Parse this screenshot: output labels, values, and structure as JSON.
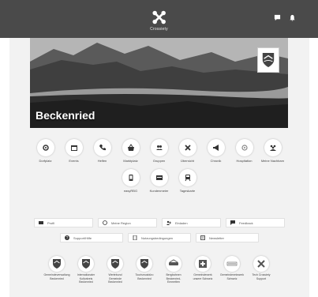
{
  "app": {
    "name": "Crossiety"
  },
  "header": {
    "icons": [
      "chat-icon",
      "bell-icon"
    ]
  },
  "hero": {
    "title": "Beckenried"
  },
  "apps": [
    {
      "label": "Dorfplatz",
      "icon": "gear-icon"
    },
    {
      "label": "Events",
      "icon": "calendar-icon"
    },
    {
      "label": "Helfen",
      "icon": "phone-icon"
    },
    {
      "label": "Marktplatz",
      "icon": "basket-icon"
    },
    {
      "label": "Gruppen",
      "icon": "people-icon"
    },
    {
      "label": "Übersicht",
      "icon": "crossiety-icon"
    },
    {
      "label": "Chronik",
      "icon": "megaphone-icon"
    },
    {
      "label": "Hospitation",
      "icon": "flower-icon"
    },
    {
      "label": "Meine Nachbarn",
      "icon": "neighbors-icon"
    },
    {
      "label": "easyRBG",
      "icon": "phone-doc-icon"
    },
    {
      "label": "Kundenmeier",
      "icon": "card-icon"
    },
    {
      "label": "Tageskarte",
      "icon": "train-icon"
    }
  ],
  "links": {
    "row1": [
      {
        "label": "Profil",
        "icon": "id-icon"
      },
      {
        "label": "Meine Region",
        "icon": "globe-icon"
      },
      {
        "label": "Einladen",
        "icon": "invite-icon"
      },
      {
        "label": "Feedback",
        "icon": "feedback-icon"
      }
    ],
    "row2": [
      {
        "label": "Support/Hilfe",
        "icon": "question-icon"
      },
      {
        "label": "Nutzungsbedingungen",
        "icon": "doc-icon"
      },
      {
        "label": "Newsletter",
        "icon": "newsletter-icon"
      }
    ]
  },
  "partners": [
    {
      "label": "Gemeindeverwaltung Beckenried",
      "icon": "crest-icon"
    },
    {
      "label": "Internationaler Kulturkreis Beckenried",
      "icon": "crest-icon"
    },
    {
      "label": "Wertebund Gemeinde Beckenried",
      "icon": "crest-icon"
    },
    {
      "label": "Tourismusbüro Beckenried",
      "icon": "crest-icon"
    },
    {
      "label": "Bergbahnen Beckenried-Emmetten",
      "icon": "klewenalp-icon"
    },
    {
      "label": "Gemeindewerk unsere Schweiz",
      "icon": "swiss-icon"
    },
    {
      "label": "Gemeindenetzwerk Schweiz",
      "icon": "gemeinden-icon"
    },
    {
      "label": "Tech Crossiety Support",
      "icon": "crossiety-icon"
    }
  ]
}
